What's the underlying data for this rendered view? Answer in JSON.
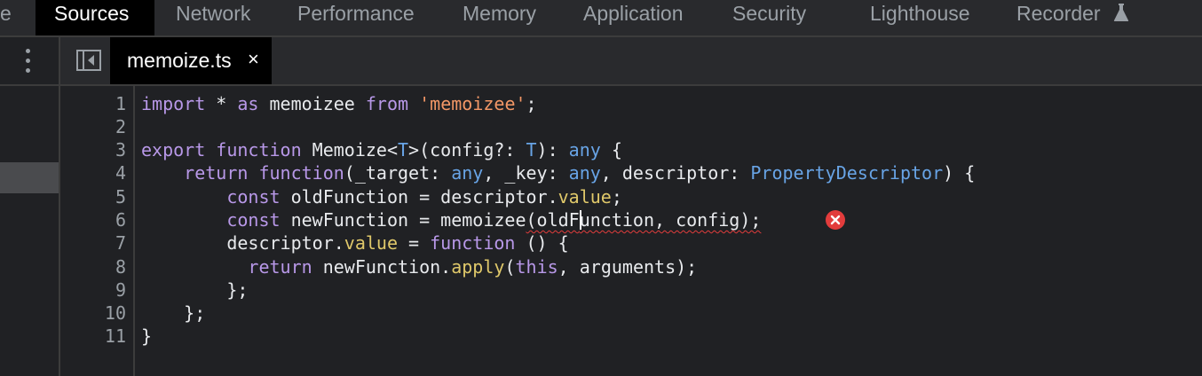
{
  "panel_tabs": [
    {
      "label": "e",
      "active": false
    },
    {
      "label": "Sources",
      "active": true
    },
    {
      "label": "Network",
      "active": false
    },
    {
      "label": "Performance",
      "active": false
    },
    {
      "label": "Memory",
      "active": false
    },
    {
      "label": "Application",
      "active": false
    },
    {
      "label": "Security",
      "active": false
    },
    {
      "label": "Lighthouse",
      "active": false
    },
    {
      "label": "Recorder",
      "active": false
    }
  ],
  "recorder_icon": "flask-icon",
  "editor": {
    "file_tab": {
      "label": "memoize.ts",
      "close_glyph": "×"
    },
    "line_numbers": [
      "1",
      "2",
      "3",
      "4",
      "5",
      "6",
      "7",
      "8",
      "9",
      "10",
      "11"
    ]
  },
  "code": {
    "l1": {
      "kw_import": "import",
      "star": " * ",
      "kw_as": "as",
      "name": " memoizee ",
      "kw_from": "from",
      "sp": " ",
      "str": "'memoizee'",
      "semi": ";"
    },
    "l3": {
      "kw_export": "export",
      "sp1": " ",
      "kw_function": "function",
      "name": " Memoize<",
      "type_t": "T",
      "sig": ">(config?: ",
      "type_t2": "T",
      "close": "): ",
      "kw_any": "any",
      "brace": " {"
    },
    "l4": {
      "indent": "    ",
      "kw_return": "return",
      "sp": " ",
      "kw_function": "function",
      "p1": "(_target: ",
      "any1": "any",
      "p2": ", _key: ",
      "any2": "any",
      "p3": ", descriptor: ",
      "type_pd": "PropertyDescriptor",
      "end": ") {"
    },
    "l5": {
      "indent": "        ",
      "kw_const": "const",
      "rest": " oldFunction = descriptor.",
      "prop": "value",
      "semi": ";"
    },
    "l6": {
      "indent": "        ",
      "kw_const": "const",
      "rest": " newFunction = memoizee",
      "err_a": "(oldF",
      "err_b": "unction, config);"
    },
    "l7": {
      "indent": "        ",
      "pre": "descriptor.",
      "prop": "value",
      "eq": " = ",
      "kw_function": "function",
      "end": " () {"
    },
    "l8": {
      "indent": "          ",
      "kw_return": "return",
      "mid": " newFunction.",
      "prop": "apply",
      "open": "(",
      "kw_this": "this",
      "end": ", arguments);"
    },
    "l9": {
      "text": "        };"
    },
    "l10": {
      "text": "    };"
    },
    "l11": {
      "text": "}"
    }
  },
  "colors": {
    "keyword": "#b898e8",
    "type": "#68a4e6",
    "string": "#f29766",
    "property": "#dfc86a",
    "error": "#e23c3c"
  },
  "icons": {
    "more": "kebab-menu-icon",
    "toggle": "toggle-navigator-icon",
    "error": "error-icon"
  }
}
